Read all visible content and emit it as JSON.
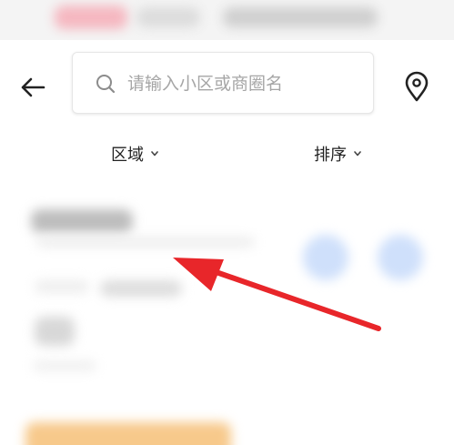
{
  "search": {
    "placeholder": "请输入小区或商圈名"
  },
  "filters": [
    {
      "label": "区域"
    },
    {
      "label": "排序"
    }
  ],
  "icons": {
    "back": "back-arrow-icon",
    "search": "search-icon",
    "location": "location-pin-icon",
    "chevron": "chevron-down-icon"
  },
  "colors": {
    "annotation_arrow": "#e8262a",
    "blurred_accent_blue": "#cfe0fb",
    "blurred_accent_orange": "#f7c98b"
  }
}
